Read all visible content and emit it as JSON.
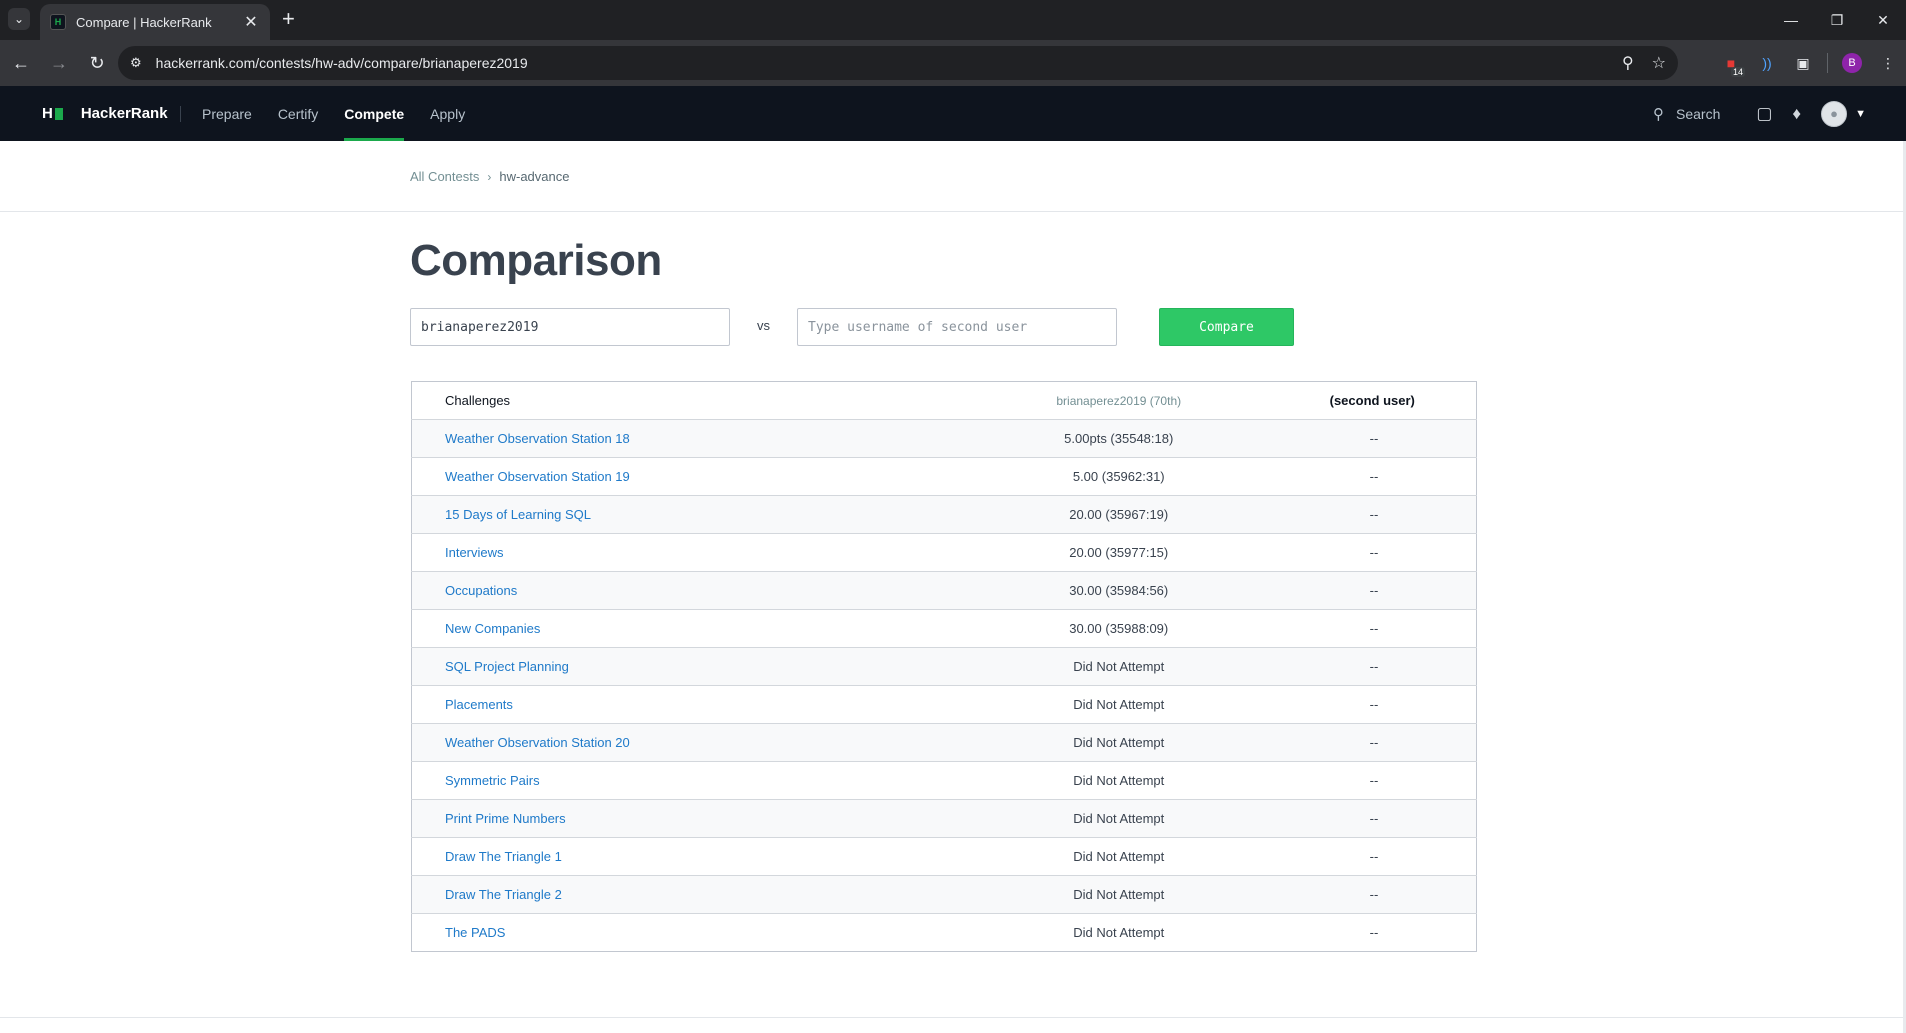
{
  "browser": {
    "tab_title": "Compare | HackerRank",
    "url": "hackerrank.com/contests/hw-adv/compare/brianaperez2019",
    "extension_badge": "14",
    "profile_initial": "B"
  },
  "nav": {
    "brand": "HackerRank",
    "links": [
      "Prepare",
      "Certify",
      "Compete",
      "Apply"
    ],
    "active_link": "Compete",
    "search_label": "Search",
    "accent_color": "#1ba94c"
  },
  "breadcrumb": {
    "root": "All Contests",
    "current": "hw-advance"
  },
  "page": {
    "title": "Comparison"
  },
  "compare_form": {
    "user1_value": "brianaperez2019",
    "vs_label": "vs",
    "user2_placeholder": "Type username of second user",
    "compare_label": "Compare",
    "button_color": "#2ec866"
  },
  "table": {
    "headers": {
      "challenges": "Challenges",
      "user1": "brianaperez2019 (70th)",
      "user2": "(second user)"
    },
    "rows": [
      {
        "name": "Weather Observation Station 18",
        "user1": "5.00pts (35548:18)",
        "user2": "--"
      },
      {
        "name": "Weather Observation Station 19",
        "user1": "5.00 (35962:31)",
        "user2": "--"
      },
      {
        "name": "15 Days of Learning SQL",
        "user1": "20.00 (35967:19)",
        "user2": "--"
      },
      {
        "name": "Interviews",
        "user1": "20.00 (35977:15)",
        "user2": "--"
      },
      {
        "name": "Occupations",
        "user1": "30.00 (35984:56)",
        "user2": "--"
      },
      {
        "name": "New Companies",
        "user1": "30.00 (35988:09)",
        "user2": "--"
      },
      {
        "name": "SQL Project Planning",
        "user1": "Did Not Attempt",
        "user2": "--"
      },
      {
        "name": "Placements",
        "user1": "Did Not Attempt",
        "user2": "--"
      },
      {
        "name": "Weather Observation Station 20",
        "user1": "Did Not Attempt",
        "user2": "--"
      },
      {
        "name": "Symmetric Pairs",
        "user1": "Did Not Attempt",
        "user2": "--"
      },
      {
        "name": "Print Prime Numbers",
        "user1": "Did Not Attempt",
        "user2": "--"
      },
      {
        "name": "Draw The Triangle 1",
        "user1": "Did Not Attempt",
        "user2": "--"
      },
      {
        "name": "Draw The Triangle 2",
        "user1": "Did Not Attempt",
        "user2": "--"
      },
      {
        "name": "The PADS",
        "user1": "Did Not Attempt",
        "user2": "--"
      }
    ]
  }
}
